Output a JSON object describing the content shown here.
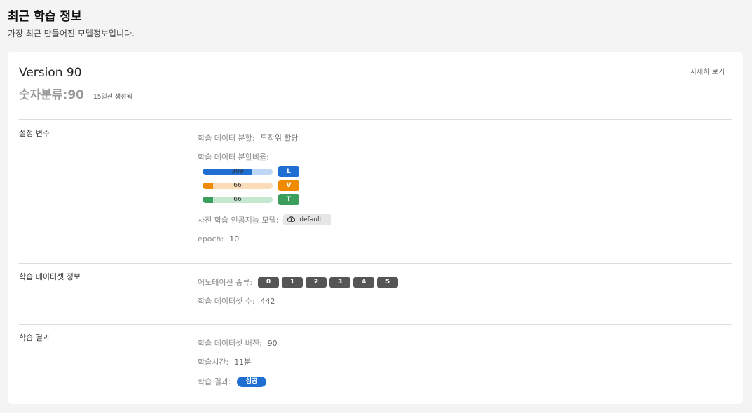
{
  "header": {
    "title": "최근 학습 정보",
    "subtitle": "가장 최근 만들어진 모델정보입니다."
  },
  "card": {
    "detail_link": "자세히 보기",
    "version": "Version 90",
    "model_name": "숫자분류:90",
    "created_ago": "15일전 생성됨"
  },
  "settings": {
    "section_label": "설정 변수",
    "split_method_label": "학습 데이터 분할:",
    "split_method_value": "무작위 할당",
    "split_ratio_label": "학습 데이터 분할비율:",
    "splits": [
      {
        "count": "309",
        "badge": "L",
        "fill_fraction": 0.7,
        "color": "#1e6fd1",
        "track": "#bdd7f5"
      },
      {
        "count": "66",
        "badge": "V",
        "fill_fraction": 0.15,
        "color": "#f08a00",
        "track": "#fbdcb8"
      },
      {
        "count": "66",
        "badge": "T",
        "fill_fraction": 0.15,
        "color": "#3c9e5d",
        "track": "#c5e6cf"
      }
    ],
    "pretrained_label": "사전 학습 인공지능 모델:",
    "pretrained_icon": "cloud-icon",
    "pretrained_value": "default",
    "epoch_label": "epoch:",
    "epoch_value": "10"
  },
  "dataset": {
    "section_label": "학습 데이터셋 정보",
    "annotation_label": "어노테이션 종류:",
    "annotations": [
      "0",
      "1",
      "2",
      "3",
      "4",
      "5"
    ],
    "count_label": "학습 데이터셋 수:",
    "count_value": "442"
  },
  "result": {
    "section_label": "학습 결과",
    "dataset_version_label": "학습 데이터셋 버전:",
    "dataset_version_value": "90",
    "train_time_label": "학습시간:",
    "train_time_value": "11분",
    "result_label": "학습 결과:",
    "result_value": "성공"
  }
}
